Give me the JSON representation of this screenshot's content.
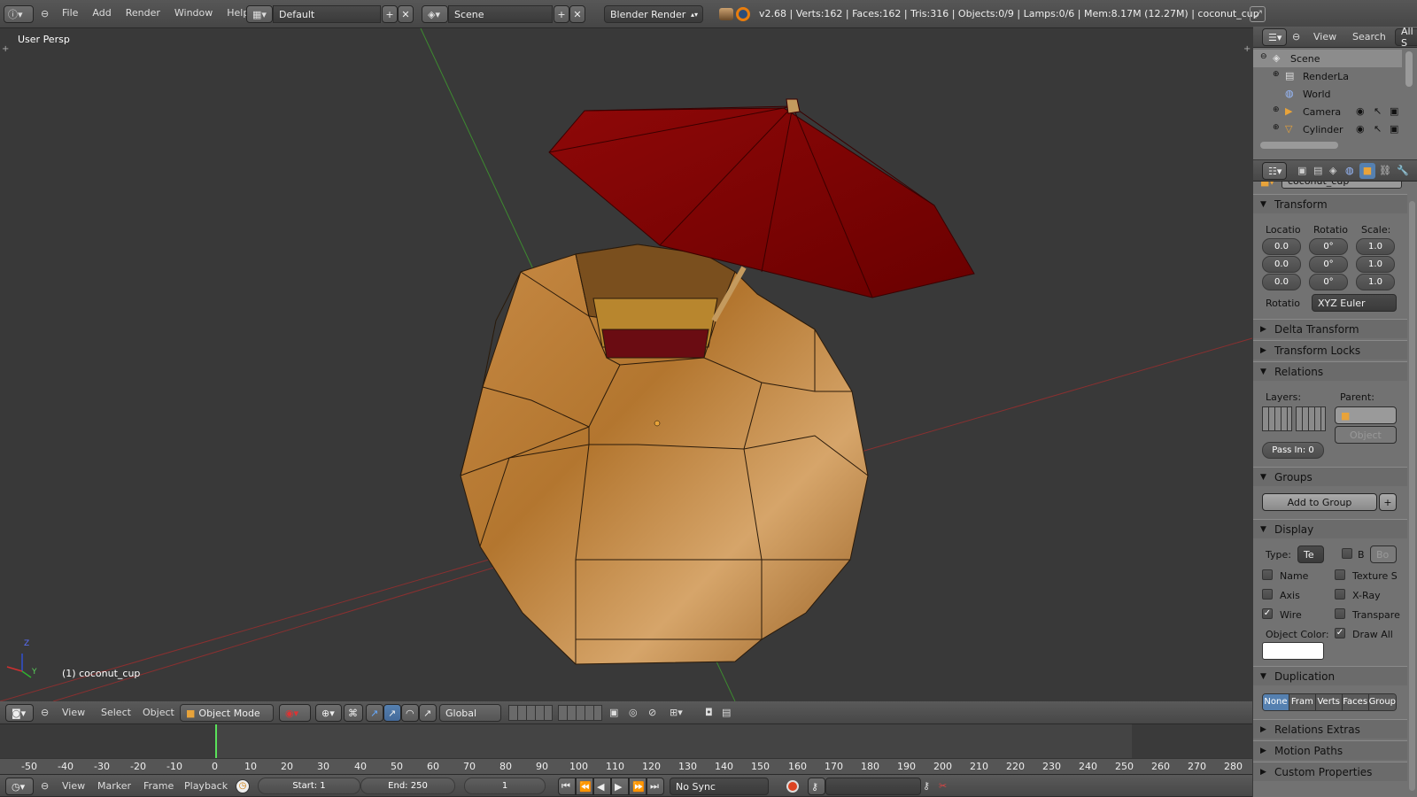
{
  "topbar": {
    "menus": [
      "File",
      "Add",
      "Render",
      "Window",
      "Help"
    ],
    "layout": "Default",
    "scene": "Scene",
    "engine": "Blender Render",
    "stats": "v2.68 | Verts:162 | Faces:162 | Tris:316 | Objects:0/9 | Lamps:0/6 | Mem:8.17M (12.27M) | coconut_cup"
  },
  "viewport": {
    "persp": "User Persp",
    "object_label": "(1) coconut_cup",
    "axis_z": "Z",
    "axis_y": "Y"
  },
  "header3d": {
    "menus": [
      "View",
      "Select",
      "Object"
    ],
    "mode": "Object Mode",
    "orientation": "Global"
  },
  "outliner": {
    "menus": [
      "View",
      "Search"
    ],
    "filter": "All S",
    "items": [
      {
        "name": "Scene"
      },
      {
        "name": "RenderLa"
      },
      {
        "name": "World"
      },
      {
        "name": "Camera"
      },
      {
        "name": "Cylinder"
      }
    ]
  },
  "props": {
    "object_name": "coconut_cup",
    "transform": "Transform",
    "loc_label": "Locatio",
    "rot_label": "Rotatio",
    "scale_label": "Scale:",
    "loc": [
      "0.0",
      "0.0",
      "0.0"
    ],
    "rot": [
      "0°",
      "0°",
      "0°"
    ],
    "scale": [
      "1.0",
      "1.0",
      "1.0"
    ],
    "rot_mode_label": "Rotatio",
    "rot_mode": "XYZ Euler",
    "delta": "Delta Transform",
    "locks": "Transform Locks",
    "relations": "Relations",
    "layers": "Layers:",
    "parent": "Parent:",
    "parent_type": "Object",
    "pass": "Pass In: 0",
    "groups": "Groups",
    "add_group": "Add to Group",
    "display": "Display",
    "type_label": "Type:",
    "type_val": "Te",
    "b_label": "B",
    "bo_val": "Bo",
    "name": "Name",
    "texture": "Texture S",
    "axis": "Axis",
    "xray": "X-Ray",
    "wire": "Wire",
    "transp": "Transpare",
    "obj_color": "Object Color:",
    "draw_all": "Draw All",
    "duplication": "Duplication",
    "dup_tabs": [
      "None",
      "Fram",
      "Verts",
      "Faces",
      "Group"
    ],
    "rel_extras": "Relations Extras",
    "motion": "Motion Paths",
    "custom": "Custom Properties"
  },
  "timeline": {
    "ticks": [
      "-50",
      "-40",
      "-30",
      "-20",
      "-10",
      "0",
      "10",
      "20",
      "30",
      "40",
      "50",
      "60",
      "70",
      "80",
      "90",
      "100",
      "110",
      "120",
      "130",
      "140",
      "150",
      "160",
      "170",
      "180",
      "190",
      "200",
      "210",
      "220",
      "230",
      "240",
      "250",
      "260",
      "270",
      "280"
    ],
    "menus": [
      "View",
      "Marker",
      "Frame",
      "Playback"
    ],
    "start": "Start: 1",
    "end": "End: 250",
    "current": "1",
    "sync": "No Sync"
  }
}
